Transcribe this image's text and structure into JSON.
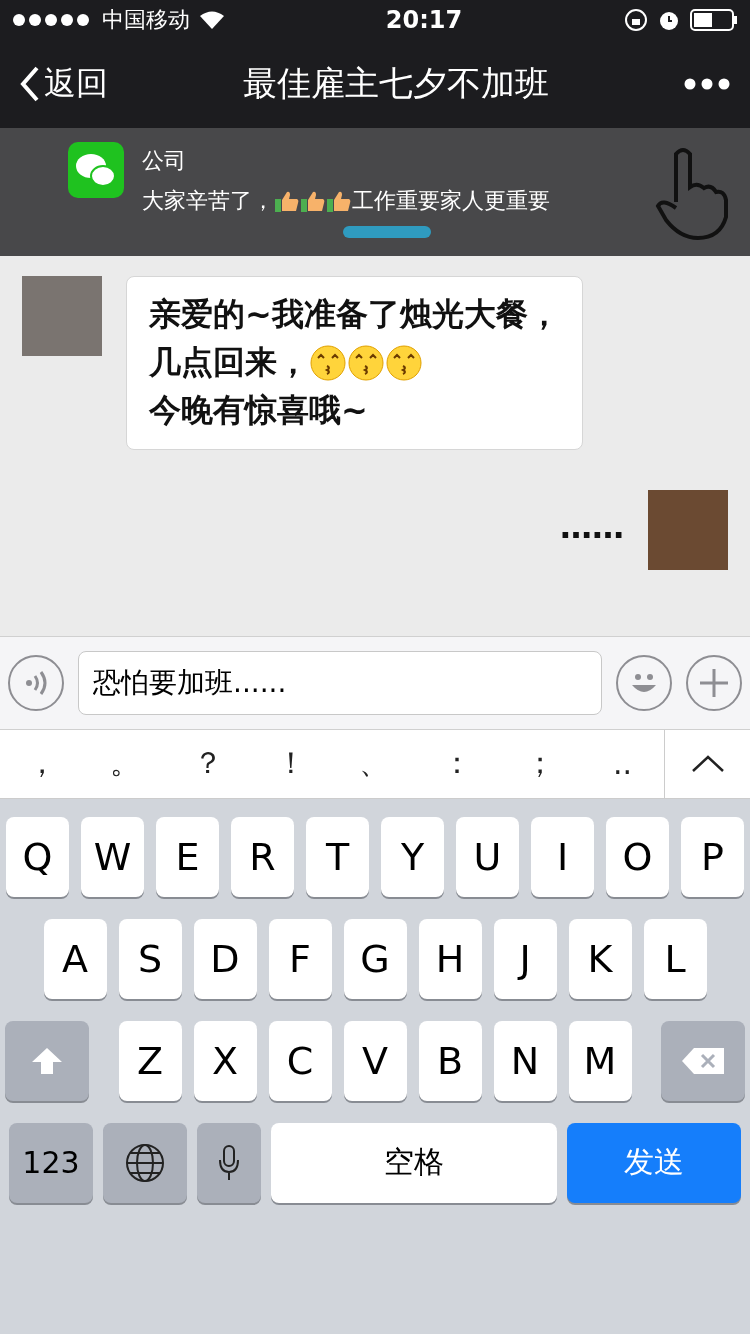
{
  "status_bar": {
    "carrier": "中国移动",
    "time": "20:17"
  },
  "nav": {
    "back": "返回",
    "title": "最佳雇主七夕不加班"
  },
  "notification": {
    "sender": "公司",
    "segments": [
      {
        "kind": "text",
        "text": "大家辛苦了，"
      },
      {
        "kind": "thumb"
      },
      {
        "kind": "thumb"
      },
      {
        "kind": "thumb"
      },
      {
        "kind": "text",
        "text": "工作重要家人更重要"
      }
    ]
  },
  "messages": [
    {
      "kind": "incoming",
      "lines": [
        [
          {
            "kind": "text",
            "text": "亲爱的~我准备了烛光大餐，"
          }
        ],
        [
          {
            "kind": "text",
            "text": "几点回来，"
          },
          {
            "kind": "kiss"
          },
          {
            "kind": "kiss"
          },
          {
            "kind": "kiss"
          }
        ],
        [
          {
            "kind": "text",
            "text": "今晚有惊喜哦~"
          }
        ]
      ]
    },
    {
      "kind": "outgoing",
      "lines": [
        [
          {
            "kind": "text",
            "text": "……"
          }
        ]
      ]
    }
  ],
  "input": {
    "value": "恐怕要加班......"
  },
  "suggestions": [
    "，",
    "。",
    "？",
    "！",
    "、",
    "：",
    "；",
    ".."
  ],
  "keyboard": {
    "rows": [
      [
        "Q",
        "W",
        "E",
        "R",
        "T",
        "Y",
        "U",
        "I",
        "O",
        "P"
      ],
      [
        "A",
        "S",
        "D",
        "F",
        "G",
        "H",
        "J",
        "K",
        "L"
      ],
      [
        "Z",
        "X",
        "C",
        "V",
        "B",
        "N",
        "M"
      ]
    ],
    "numbers": "123",
    "space": "空格",
    "send": "发送"
  }
}
